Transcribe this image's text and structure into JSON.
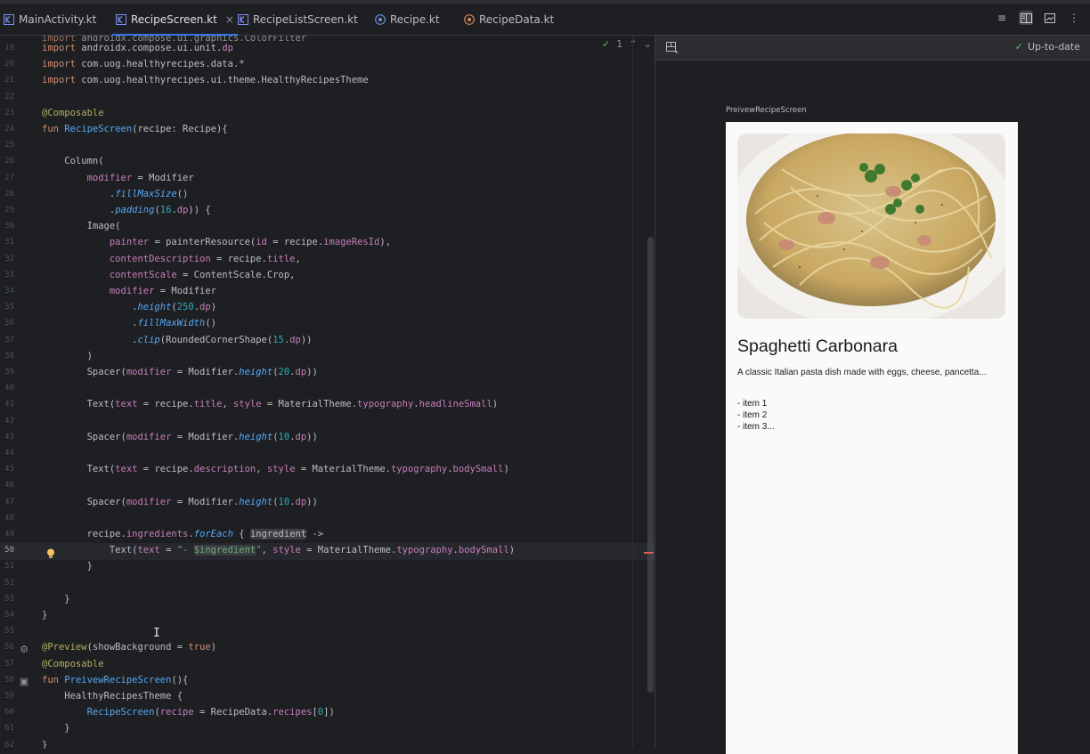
{
  "tabs": [
    {
      "label": "MainActivity.kt",
      "icon": "kotlin-file-icon"
    },
    {
      "label": "RecipeScreen.kt",
      "icon": "kotlin-file-icon",
      "active": true,
      "close": "×"
    },
    {
      "label": "RecipeListScreen.kt",
      "icon": "kotlin-file-icon"
    },
    {
      "label": "Recipe.kt",
      "icon": "kotlin-class-icon"
    },
    {
      "label": "RecipeData.kt",
      "icon": "kotlin-object-icon"
    }
  ],
  "view_modes": [
    "code-view-icon",
    "split-view-icon",
    "design-view-icon",
    "more-icon"
  ],
  "inspections": {
    "count": "1"
  },
  "line_numbers": [
    "19",
    "20",
    "21",
    "22",
    "23",
    "24",
    "25",
    "26",
    "27",
    "28",
    "29",
    "30",
    "31",
    "32",
    "33",
    "34",
    "35",
    "36",
    "37",
    "38",
    "39",
    "40",
    "41",
    "42",
    "43",
    "44",
    "45",
    "46",
    "47",
    "48",
    "49",
    "50",
    "51",
    "52",
    "53",
    "54",
    "55",
    "56",
    "57",
    "58",
    "59",
    "60",
    "61",
    "62"
  ],
  "code_lines": [
    [
      "import androidx.compose.ui.unit.dp"
    ],
    [
      "import com.uog.healthyrecipes.data.*"
    ],
    [
      "import com.uog.healthyrecipes.ui.theme.HealthyRecipesTheme"
    ],
    [
      ""
    ],
    [
      "@Composable"
    ],
    [
      "fun RecipeScreen(recipe: Recipe){"
    ],
    [
      ""
    ],
    [
      "    Column("
    ],
    [
      "        modifier = Modifier"
    ],
    [
      "            .fillMaxSize()"
    ],
    [
      "            .padding(16.dp)) {"
    ],
    [
      "        Image("
    ],
    [
      "            painter = painterResource(id = recipe.imageResId),"
    ],
    [
      "            contentDescription = recipe.title,"
    ],
    [
      "            contentScale = ContentScale.Crop,"
    ],
    [
      "            modifier = Modifier"
    ],
    [
      "                .height(250.dp)"
    ],
    [
      "                .fillMaxWidth()"
    ],
    [
      "                .clip(RoundedCornerShape(15.dp))"
    ],
    [
      "        )"
    ],
    [
      "        Spacer(modifier = Modifier.height(20.dp))"
    ],
    [
      ""
    ],
    [
      "        Text(text = recipe.title, style = MaterialTheme.typography.headlineSmall)"
    ],
    [
      ""
    ],
    [
      "        Spacer(modifier = Modifier.height(10.dp))"
    ],
    [
      ""
    ],
    [
      "        Text(text = recipe.description, style = MaterialTheme.typography.bodySmall)"
    ],
    [
      ""
    ],
    [
      "        Spacer(modifier = Modifier.height(10.dp))"
    ],
    [
      ""
    ],
    [
      "        recipe.ingredients.forEach { ingredient ->"
    ],
    [
      "            Text(text = \"- $ingredient\", style = MaterialTheme.typography.bodySmall)"
    ],
    [
      "        }"
    ],
    [
      ""
    ],
    [
      "    }"
    ],
    [
      "}"
    ],
    [
      ""
    ],
    [
      "@Preview(showBackground = true)"
    ],
    [
      "@Composable"
    ],
    [
      "fun PreivewRecipeScreen(){"
    ],
    [
      "    HealthyRecipesTheme {"
    ],
    [
      "        RecipeScreen(recipe = RecipeData.recipes[0])"
    ],
    [
      "    }"
    ],
    [
      "}"
    ]
  ],
  "preview": {
    "status": "Up-to-date",
    "composable_name": "PreivewRecipeScreen",
    "recipe_title": "Spaghetti Carbonara",
    "recipe_description": "A classic Italian pasta dish made with eggs, cheese, pancetta...",
    "ingredients": [
      "- item 1",
      "- item 2",
      "- item 3..."
    ]
  }
}
